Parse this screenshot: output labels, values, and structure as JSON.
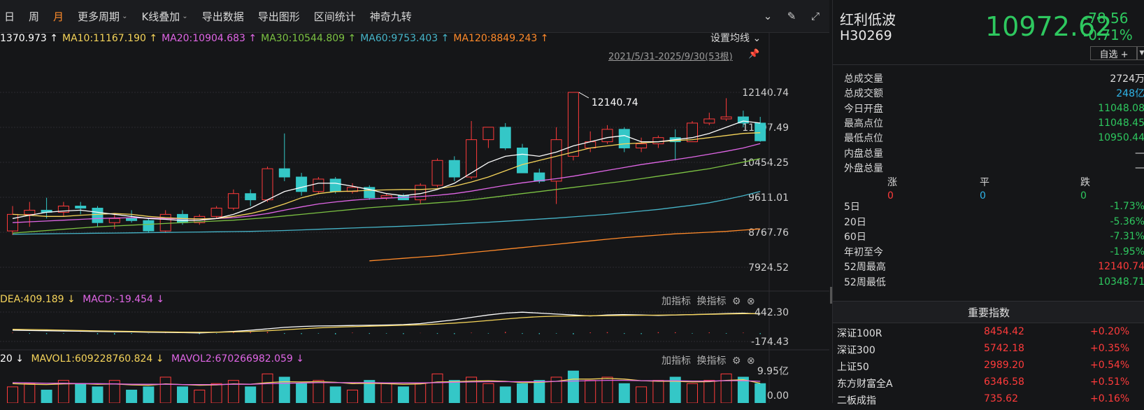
{
  "toolbar": {
    "items": [
      {
        "label": "日",
        "active": false
      },
      {
        "label": "周",
        "active": false
      },
      {
        "label": "月",
        "active": true
      },
      {
        "label": "更多周期",
        "caret": true
      },
      {
        "label": "K线叠加",
        "caret": true
      },
      {
        "label": "导出数据"
      },
      {
        "label": "导出图形"
      },
      {
        "label": "区间统计"
      },
      {
        "label": "神奇九转"
      }
    ],
    "icons": [
      "chevron-circle-icon",
      "brush-icon",
      "fullscreen-icon"
    ]
  },
  "ma_line": {
    "ma5": "1370.973 ↑",
    "ma10": "MA10:11167.190 ↑",
    "ma20": "MA20:10904.683 ↑",
    "ma30": "MA30:10544.809 ↑",
    "ma60": "MA60:9753.403 ↑",
    "ma120": "MA120:8849.243 ↑",
    "settings": "设置均线 ⌄"
  },
  "range_label": "2021/5/31-2025/9/30(53根)",
  "peak_label": "12140.74",
  "price_axis": [
    "12140.74",
    "11297.49",
    "10454.25",
    "9611.01",
    "8767.76",
    "7924.52"
  ],
  "macd": {
    "dea": "DEA:409.189 ↓",
    "macd": "MACD:-19.454 ↓",
    "axis_top": "442.30",
    "axis_bottom": "-174.43",
    "add": "加指标",
    "switch": "换指标"
  },
  "vol": {
    "ma_prefix": "20 ↓",
    "mavol1": "MAVOL1:609228760.824 ↓",
    "mavol2": "MAVOL2:670266982.059 ↓",
    "axis_top": "9.95亿",
    "axis_bottom": "0.00",
    "add": "加指标",
    "switch": "换指标"
  },
  "colors": {
    "up": "#ff3b3b",
    "down": "#34c7c7",
    "ma5": "#ffffff",
    "ma10": "#f5d45a",
    "ma20": "#e066e6",
    "ma30": "#7cc243",
    "ma60": "#46b4c8",
    "ma120": "#ff8a2a"
  },
  "stock": {
    "name": "红利低波",
    "code": "H30269",
    "price": "10972.62",
    "change": "-78.56",
    "change_pct": "-0.71%",
    "fav_label": "自选 +"
  },
  "stats": [
    {
      "label": "总成交量",
      "value": "2724万",
      "color": "white"
    },
    {
      "label": "总成交额",
      "value": "248亿",
      "color": "cyan"
    },
    {
      "label": "今日开盘",
      "value": "11048.08",
      "color": "green"
    },
    {
      "label": "最高点位",
      "value": "11048.45",
      "color": "green"
    },
    {
      "label": "最低点位",
      "value": "10950.44",
      "color": "green"
    },
    {
      "label": "内盘总量",
      "value": "—",
      "color": "white"
    },
    {
      "label": "外盘总量",
      "value": "—",
      "color": "white"
    }
  ],
  "zpd": {
    "up_label": "涨",
    "flat_label": "平",
    "down_label": "跌",
    "up": "0",
    "flat": "0",
    "down": "0"
  },
  "periods": [
    {
      "label": "5日",
      "value": "-1.73%",
      "color": "green"
    },
    {
      "label": "20日",
      "value": "-5.36%",
      "color": "green"
    },
    {
      "label": "60日",
      "value": "-7.31%",
      "color": "green"
    },
    {
      "label": "年初至今",
      "value": "-1.95%",
      "color": "green"
    },
    {
      "label": "52周最高",
      "value": "12140.74",
      "color": "red"
    },
    {
      "label": "52周最低",
      "value": "10348.71",
      "color": "green"
    }
  ],
  "indices_title": "重要指数",
  "indices": [
    {
      "name": "深证100R",
      "price": "8454.42",
      "change": "+0.20%"
    },
    {
      "name": "深证300",
      "price": "5742.18",
      "change": "+0.35%"
    },
    {
      "name": "上证50",
      "price": "2989.20",
      "change": "+0.54%"
    },
    {
      "name": "东方财富全A",
      "price": "6346.58",
      "change": "+0.51%"
    },
    {
      "name": "二板成指",
      "price": "735.62",
      "change": "+0.16%"
    }
  ],
  "chart_data": {
    "type": "candlestick",
    "title": "",
    "x_range": [
      "2021/5/31",
      "2025/9/30"
    ],
    "y_range": [
      7924.52,
      12140.74
    ],
    "candles": [
      {
        "o": 8800,
        "h": 9400,
        "l": 8700,
        "c": 9200
      },
      {
        "o": 9200,
        "h": 9500,
        "l": 8900,
        "c": 9300
      },
      {
        "o": 9300,
        "h": 9600,
        "l": 9100,
        "c": 9250
      },
      {
        "o": 9250,
        "h": 9500,
        "l": 9150,
        "c": 9400
      },
      {
        "o": 9400,
        "h": 9500,
        "l": 9200,
        "c": 9350
      },
      {
        "o": 9350,
        "h": 9400,
        "l": 8900,
        "c": 9000
      },
      {
        "o": 9000,
        "h": 9200,
        "l": 8850,
        "c": 9100
      },
      {
        "o": 9100,
        "h": 9300,
        "l": 9000,
        "c": 9050
      },
      {
        "o": 9050,
        "h": 9100,
        "l": 8750,
        "c": 8800
      },
      {
        "o": 8800,
        "h": 9300,
        "l": 8750,
        "c": 9200
      },
      {
        "o": 9200,
        "h": 9300,
        "l": 8950,
        "c": 9000
      },
      {
        "o": 9000,
        "h": 9200,
        "l": 8950,
        "c": 9150
      },
      {
        "o": 9150,
        "h": 9400,
        "l": 9100,
        "c": 9350
      },
      {
        "o": 9350,
        "h": 9800,
        "l": 9300,
        "c": 9700
      },
      {
        "o": 9700,
        "h": 9800,
        "l": 9400,
        "c": 9550
      },
      {
        "o": 9550,
        "h": 10350,
        "l": 9500,
        "c": 10300
      },
      {
        "o": 10300,
        "h": 11150,
        "l": 10000,
        "c": 10100
      },
      {
        "o": 10100,
        "h": 10200,
        "l": 9650,
        "c": 9750
      },
      {
        "o": 9750,
        "h": 10100,
        "l": 9700,
        "c": 10050
      },
      {
        "o": 10050,
        "h": 10100,
        "l": 9700,
        "c": 9750
      },
      {
        "o": 9750,
        "h": 9950,
        "l": 9700,
        "c": 9850
      },
      {
        "o": 9850,
        "h": 9900,
        "l": 9550,
        "c": 9600
      },
      {
        "o": 9600,
        "h": 9700,
        "l": 9550,
        "c": 9650
      },
      {
        "o": 9650,
        "h": 9700,
        "l": 9550,
        "c": 9550
      },
      {
        "o": 9550,
        "h": 9950,
        "l": 9450,
        "c": 9900
      },
      {
        "o": 9900,
        "h": 10550,
        "l": 9850,
        "c": 10500
      },
      {
        "o": 10500,
        "h": 10600,
        "l": 10000,
        "c": 10100
      },
      {
        "o": 10100,
        "h": 11450,
        "l": 10050,
        "c": 11000
      },
      {
        "o": 11000,
        "h": 11300,
        "l": 10800,
        "c": 11300
      },
      {
        "o": 11300,
        "h": 11400,
        "l": 10750,
        "c": 10800
      },
      {
        "o": 10800,
        "h": 10900,
        "l": 10200,
        "c": 10200
      },
      {
        "o": 10200,
        "h": 10300,
        "l": 9950,
        "c": 10000
      },
      {
        "o": 10000,
        "h": 11300,
        "l": 9450,
        "c": 11000
      },
      {
        "o": 10600,
        "h": 12140.74,
        "l": 10500,
        "c": 12140.74
      },
      {
        "o": 10800,
        "h": 11200,
        "l": 10700,
        "c": 10950
      },
      {
        "o": 10950,
        "h": 11350,
        "l": 10900,
        "c": 11250
      },
      {
        "o": 11250,
        "h": 11300,
        "l": 10700,
        "c": 10800
      },
      {
        "o": 10800,
        "h": 11050,
        "l": 10700,
        "c": 10900
      },
      {
        "o": 10900,
        "h": 11100,
        "l": 10800,
        "c": 11050
      },
      {
        "o": 11050,
        "h": 11250,
        "l": 10500,
        "c": 10950
      },
      {
        "o": 10950,
        "h": 11450,
        "l": 10950,
        "c": 11400
      },
      {
        "o": 11400,
        "h": 11650,
        "l": 11350,
        "c": 11500
      },
      {
        "o": 11500,
        "h": 12000,
        "l": 11450,
        "c": 11550
      },
      {
        "o": 11550,
        "h": 11700,
        "l": 11300,
        "c": 11400
      },
      {
        "o": 11400,
        "h": 11550,
        "l": 10950,
        "c": 10972.62
      }
    ],
    "ma5": [
      9100,
      9180,
      9250,
      9280,
      9300,
      9250,
      9200,
      9150,
      9100,
      9080,
      9050,
      9060,
      9100,
      9200,
      9350,
      9550,
      9750,
      9850,
      9950,
      9950,
      9880,
      9800,
      9700,
      9650,
      9700,
      9800,
      9950,
      10200,
      10450,
      10600,
      10650,
      10600,
      10700,
      10850,
      10950,
      11050,
      11100,
      10950,
      10950,
      11000,
      11050,
      11150,
      11300,
      11450,
      11400
    ],
    "ma10": [
      9200,
      9180,
      9150,
      9150,
      9180,
      9200,
      9220,
      9200,
      9150,
      9120,
      9100,
      9090,
      9100,
      9150,
      9220,
      9320,
      9450,
      9600,
      9700,
      9750,
      9760,
      9780,
      9790,
      9800,
      9800,
      9820,
      9880,
      9980,
      10100,
      10250,
      10400,
      10500,
      10600,
      10700,
      10800,
      10850,
      10900,
      10920,
      10950,
      10980,
      11000,
      11050,
      11100,
      11150,
      11167.19
    ],
    "ma20": [
      9000,
      9020,
      9040,
      9060,
      9080,
      9100,
      9110,
      9120,
      9110,
      9100,
      9090,
      9090,
      9100,
      9120,
      9160,
      9220,
      9300,
      9380,
      9450,
      9500,
      9540,
      9570,
      9590,
      9610,
      9630,
      9660,
      9700,
      9760,
      9830,
      9900,
      9960,
      10010,
      10060,
      10120,
      10190,
      10260,
      10330,
      10400,
      10460,
      10520,
      10580,
      10650,
      10720,
      10800,
      10904.68
    ],
    "ma30": [
      8750,
      8780,
      8810,
      8840,
      8870,
      8900,
      8920,
      8940,
      8960,
      8980,
      9000,
      9020,
      9040,
      9060,
      9090,
      9120,
      9160,
      9200,
      9240,
      9280,
      9320,
      9360,
      9390,
      9420,
      9450,
      9480,
      9510,
      9550,
      9600,
      9650,
      9700,
      9750,
      9800,
      9850,
      9900,
      9950,
      10000,
      10060,
      10120,
      10180,
      10240,
      10300,
      10380,
      10460,
      10544.81
    ],
    "ma60": [
      8720,
      8725,
      8730,
      8735,
      8740,
      8745,
      8750,
      8755,
      8760,
      8765,
      8770,
      8775,
      8780,
      8785,
      8790,
      8800,
      8810,
      8825,
      8840,
      8855,
      8870,
      8885,
      8900,
      8915,
      8930,
      8950,
      8970,
      8990,
      9010,
      9035,
      9060,
      9085,
      9110,
      9140,
      9170,
      9200,
      9240,
      9280,
      9320,
      9370,
      9420,
      9480,
      9560,
      9650,
      9753.4
    ],
    "ma120": [
      null,
      null,
      null,
      null,
      null,
      null,
      null,
      null,
      null,
      null,
      null,
      null,
      null,
      null,
      null,
      null,
      null,
      null,
      null,
      null,
      null,
      8080,
      8110,
      8140,
      8170,
      8200,
      8240,
      8280,
      8320,
      8360,
      8400,
      8440,
      8480,
      8520,
      8560,
      8600,
      8640,
      8670,
      8700,
      8730,
      8750,
      8770,
      8790,
      8820,
      8849.24
    ],
    "macd_hist": [
      10,
      -15,
      -20,
      -10,
      5,
      -25,
      -30,
      -15,
      -5,
      8,
      12,
      -20,
      -10,
      15,
      20,
      25,
      -15,
      -20,
      -10,
      -25,
      10,
      -15,
      -10,
      -20,
      5,
      -15,
      -20,
      10,
      -10,
      25,
      -15,
      -20,
      -10,
      -25,
      15,
      20,
      -15,
      -20,
      20,
      18,
      -10,
      15,
      -12,
      10,
      -19.45
    ],
    "macd_dif": [
      60,
      55,
      50,
      45,
      40,
      35,
      30,
      25,
      20,
      15,
      10,
      5,
      20,
      35,
      60,
      90,
      120,
      140,
      150,
      155,
      160,
      165,
      170,
      180,
      200,
      240,
      280,
      330,
      380,
      420,
      440,
      420,
      400,
      380,
      360,
      380,
      390,
      380,
      370,
      380,
      390,
      400,
      410,
      420,
      400
    ],
    "macd_dea": [
      80,
      75,
      70,
      62,
      55,
      48,
      42,
      36,
      30,
      25,
      20,
      18,
      20,
      25,
      35,
      50,
      70,
      90,
      110,
      125,
      135,
      145,
      155,
      165,
      175,
      190,
      210,
      235,
      265,
      295,
      325,
      345,
      355,
      360,
      365,
      368,
      372,
      375,
      378,
      382,
      388,
      395,
      402,
      408,
      409.19
    ],
    "volume": [
      5,
      6,
      4,
      7,
      6,
      5,
      7,
      4,
      5,
      8,
      5,
      4,
      6,
      7,
      5,
      9,
      8,
      6,
      7,
      5,
      4,
      7,
      6,
      5,
      6,
      9,
      7,
      8,
      6,
      5,
      6,
      7,
      8,
      9.9,
      7,
      8,
      6,
      5,
      7,
      8,
      6,
      7,
      9,
      8,
      6
    ],
    "vol_up": [
      true,
      true,
      false,
      true,
      false,
      false,
      true,
      false,
      false,
      true,
      false,
      true,
      true,
      true,
      false,
      true,
      false,
      false,
      true,
      false,
      true,
      false,
      true,
      false,
      true,
      true,
      false,
      true,
      true,
      false,
      false,
      false,
      true,
      false,
      true,
      true,
      false,
      true,
      true,
      false,
      true,
      true,
      true,
      false,
      false
    ],
    "mavol1": [
      6.0,
      5.8,
      5.7,
      5.9,
      6.0,
      5.8,
      5.9,
      5.6,
      5.5,
      5.9,
      5.7,
      5.5,
      5.6,
      5.9,
      5.8,
      6.3,
      6.6,
      6.5,
      6.6,
      6.4,
      6.0,
      6.1,
      6.0,
      5.8,
      5.9,
      6.5,
      6.6,
      6.8,
      6.9,
      6.7,
      6.3,
      6.4,
      6.7,
      7.4,
      7.4,
      7.6,
      7.4,
      6.9,
      6.7,
      6.7,
      6.5,
      6.6,
      7.0,
      7.2,
      6.1
    ],
    "mavol2": [
      6.3,
      6.2,
      6.1,
      6.1,
      6.0,
      6.0,
      5.9,
      5.8,
      5.8,
      5.8,
      5.7,
      5.7,
      5.7,
      5.8,
      5.8,
      6.0,
      6.1,
      6.2,
      6.3,
      6.3,
      6.3,
      6.3,
      6.2,
      6.2,
      6.2,
      6.3,
      6.4,
      6.5,
      6.6,
      6.6,
      6.6,
      6.6,
      6.7,
      6.8,
      6.9,
      7.0,
      7.0,
      6.9,
      6.9,
      6.9,
      6.8,
      6.8,
      6.9,
      6.9,
      6.7
    ]
  }
}
